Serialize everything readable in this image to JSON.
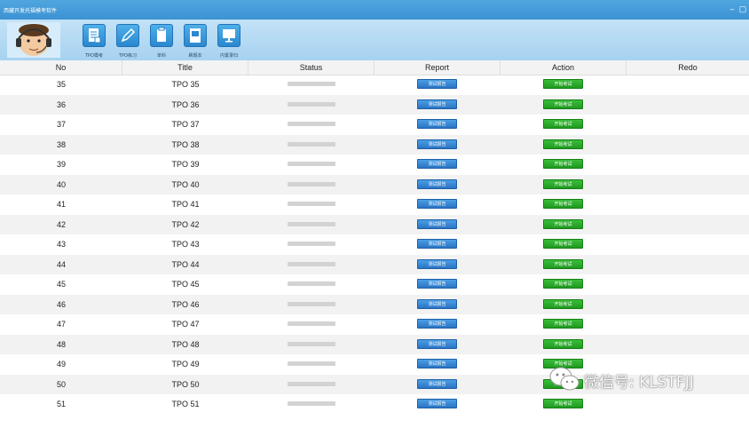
{
  "app": {
    "title": "西藏开发托福模考软件"
  },
  "window_controls": {
    "minimize": "–",
    "restore": "▢"
  },
  "toolbar": {
    "items": [
      {
        "label": "TPO模考",
        "icon": "test-paper-icon"
      },
      {
        "label": "TPO练习",
        "icon": "pencil-icon"
      },
      {
        "label": "单科",
        "icon": "clipboard-icon"
      },
      {
        "label": "刷题本",
        "icon": "notebook-icon"
      },
      {
        "label": "内置录归",
        "icon": "monitor-icon"
      }
    ]
  },
  "table": {
    "columns": [
      "No",
      "Title",
      "Status",
      "Report",
      "Action",
      "Redo"
    ],
    "report_label": "测试报告",
    "action_label": "开始考试",
    "rows": [
      {
        "no": "35",
        "title": "TPO 35"
      },
      {
        "no": "36",
        "title": "TPO 36"
      },
      {
        "no": "37",
        "title": "TPO 37"
      },
      {
        "no": "38",
        "title": "TPO 38"
      },
      {
        "no": "39",
        "title": "TPO 39"
      },
      {
        "no": "40",
        "title": "TPO 40"
      },
      {
        "no": "41",
        "title": "TPO 41"
      },
      {
        "no": "42",
        "title": "TPO 42"
      },
      {
        "no": "43",
        "title": "TPO 43"
      },
      {
        "no": "44",
        "title": "TPO 44"
      },
      {
        "no": "45",
        "title": "TPO 45"
      },
      {
        "no": "46",
        "title": "TPO 46"
      },
      {
        "no": "47",
        "title": "TPO 47"
      },
      {
        "no": "48",
        "title": "TPO 48"
      },
      {
        "no": "49",
        "title": "TPO 49"
      },
      {
        "no": "50",
        "title": "TPO 50"
      },
      {
        "no": "51",
        "title": "TPO 51"
      }
    ]
  },
  "watermark": {
    "text": "微信号: KLSTFJJ"
  },
  "colors": {
    "titlebar": "#3c92d3",
    "toolbar": "#b3daf3",
    "report_button": "#2a74c4",
    "action_button": "#1f9a1f"
  }
}
